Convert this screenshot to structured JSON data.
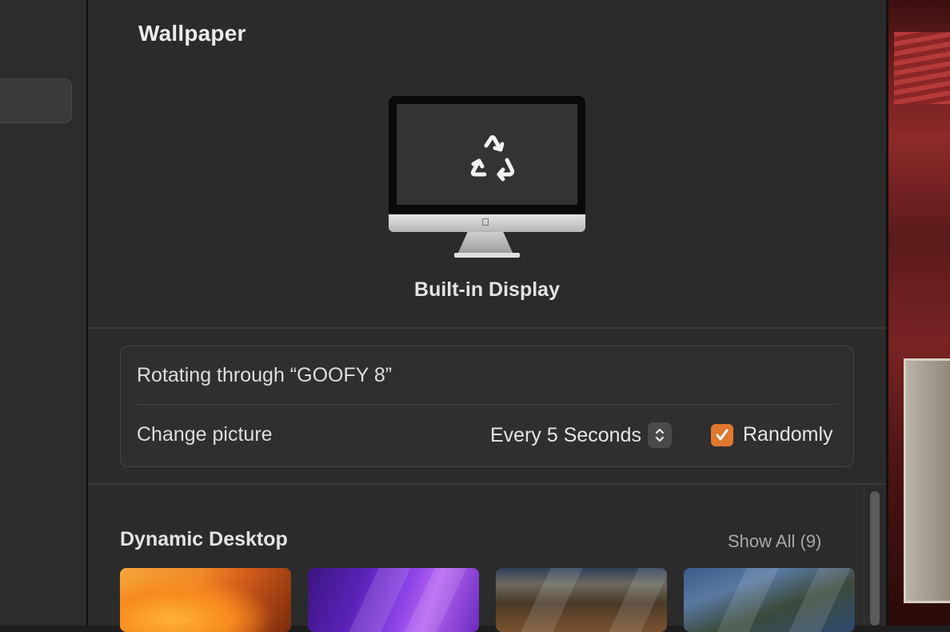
{
  "window": {
    "title": "Wallpaper"
  },
  "preview": {
    "display_name": "Built-in Display",
    "screen_icon": "recycle-arrows-icon"
  },
  "rotation": {
    "label": "Rotating through “GOOFY 8”",
    "change_label": "Change picture",
    "interval": "Every 5 Seconds",
    "randomly_label": "Randomly",
    "randomly_checked": true
  },
  "dynamic_desktop": {
    "title": "Dynamic Desktop",
    "show_all": "Show All (9)",
    "thumbnails": [
      "ventura-orange",
      "ventura-purple",
      "big-sur-coast",
      "catalina-island"
    ]
  },
  "colors": {
    "accent": "#e0782f",
    "background": "#2b2b2b"
  }
}
